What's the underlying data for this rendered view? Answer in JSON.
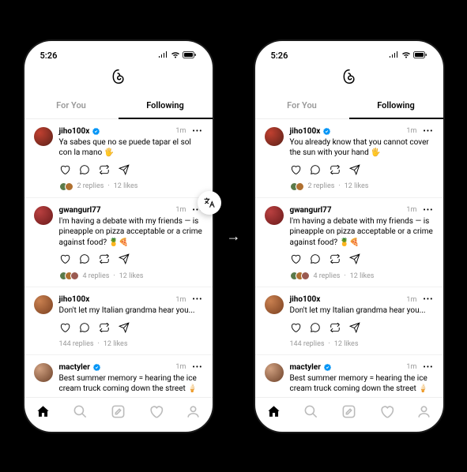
{
  "status": {
    "time": "5:26"
  },
  "tabs": {
    "forYou": "For You",
    "following": "Following"
  },
  "arrow_glyph": "→",
  "left": {
    "posts": [
      {
        "user": "jiho100x",
        "verified": true,
        "time": "1m",
        "text": "Ya sabes que no se puede tapar el sol con la mano 🖐️",
        "replies": "2 replies",
        "likes": "12 likes",
        "miniAvatars": 2
      },
      {
        "user": "gwangurl77",
        "verified": false,
        "time": "1m",
        "text": "I'm having a debate with my friends — is pineapple on pizza acceptable or a crime against food? 🍍🍕",
        "replies": "4 replies",
        "likes": "12 likes",
        "miniAvatars": 3
      },
      {
        "user": "jiho100x",
        "verified": false,
        "time": "1m",
        "text": "Don't let my Italian grandma hear you...",
        "replies": "144 replies",
        "likes": "12 likes",
        "miniAvatars": 0
      },
      {
        "user": "mactyler",
        "verified": true,
        "time": "1m",
        "text": "Best summer memory = hearing the ice cream truck coming down the street 🍦",
        "replies": "",
        "likes": "",
        "miniAvatars": 0
      }
    ]
  },
  "right": {
    "posts": [
      {
        "user": "jiho100x",
        "verified": true,
        "time": "1m",
        "text": "You already know that you cannot cover the sun with your hand 🖐️",
        "replies": "2 replies",
        "likes": "12 likes",
        "miniAvatars": 2
      },
      {
        "user": "gwangurl77",
        "verified": false,
        "time": "1m",
        "text": "I'm having a debate with my friends — is pineapple on pizza acceptable or a crime against food? 🍍🍕",
        "replies": "4 replies",
        "likes": "12 likes",
        "miniAvatars": 3
      },
      {
        "user": "jiho100x",
        "verified": false,
        "time": "1m",
        "text": "Don't let my Italian grandma hear you...",
        "replies": "144 replies",
        "likes": "12 likes",
        "miniAvatars": 0
      },
      {
        "user": "mactyler",
        "verified": true,
        "time": "1m",
        "text": "Best summer memory = hearing the ice cream truck coming down the street 🍦",
        "replies": "",
        "likes": "",
        "miniAvatars": 0
      }
    ]
  }
}
